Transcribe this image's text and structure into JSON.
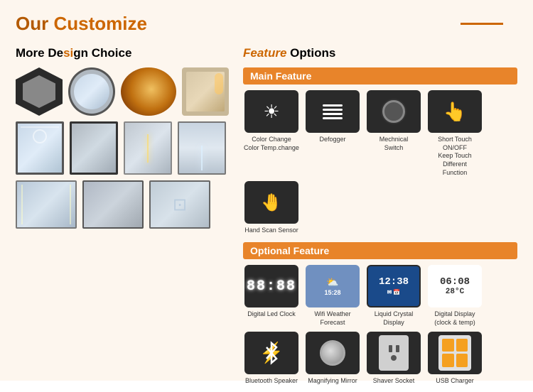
{
  "header": {
    "title_prefix": "Our ",
    "title_highlight": "Customize",
    "line": true
  },
  "left": {
    "section_title_prefix": "More De",
    "section_title_highlight": "si",
    "section_title_suffix": "gn Choice"
  },
  "right": {
    "section_title_prefix": "",
    "section_title_highlight": "Feature",
    "section_title_suffix": " Options",
    "main_feature": {
      "label": "Main Feature",
      "items": [
        {
          "id": "color-change",
          "label": "Color Change\nColor Temp.change"
        },
        {
          "id": "defogger",
          "label": "Defogger"
        },
        {
          "id": "mechanical-switch",
          "label": "Mechnical\nSwitch"
        },
        {
          "id": "short-touch",
          "label": "Short Touch ON/OFF\nKeep Touch Different\nFunction"
        },
        {
          "id": "hand-scan",
          "label": "Hand Scan Sensor"
        }
      ]
    },
    "optional_feature": {
      "label": "Optional Feature",
      "items": [
        {
          "id": "digital-led-clock",
          "label": "Digital Led Clock"
        },
        {
          "id": "wifi-weather",
          "label": "Wifi Weather Forecast"
        },
        {
          "id": "lcd",
          "label": "Liquid Crystal Display"
        },
        {
          "id": "digital-display",
          "label": "Digital Display\n(clock & temp)"
        },
        {
          "id": "bluetooth",
          "label": "Bluetooth Speaker"
        },
        {
          "id": "magnifying",
          "label": "Magnifying Mirror"
        },
        {
          "id": "shaver",
          "label": "Shaver Socket"
        },
        {
          "id": "usb",
          "label": "USB Charger"
        }
      ]
    }
  },
  "colors": {
    "accent": "#cc6600",
    "orange": "#e8842a",
    "bg": "#fdf6ee"
  }
}
